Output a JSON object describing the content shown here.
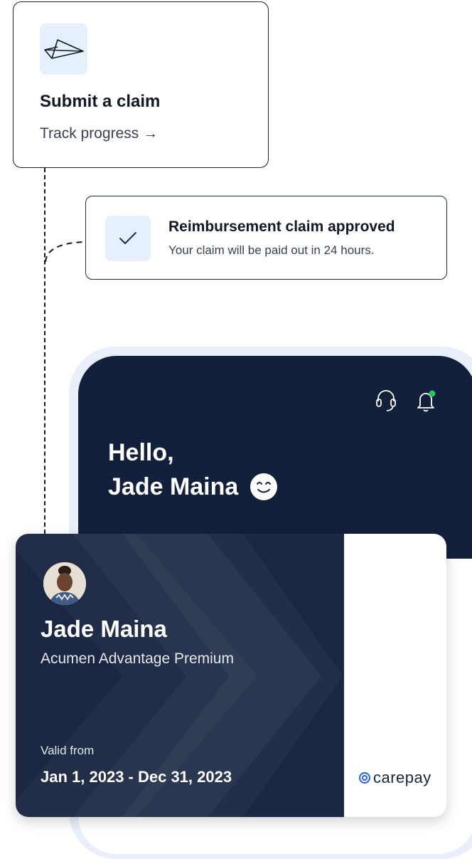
{
  "claim_card": {
    "title": "Submit a claim",
    "link": "Track progress →"
  },
  "notification": {
    "title": "Reimbursement claim approved",
    "subtitle": "Your claim will be paid out in 24 hours."
  },
  "phone": {
    "greeting_line1": "Hello,",
    "greeting_line2": "Jade Maina",
    "emoji_icon": "smiling-face-icon"
  },
  "member_card": {
    "name": "Jade Maina",
    "plan": "Acumen Advantage Premium",
    "valid_label": "Valid from",
    "valid_dates": "Jan 1, 2023 - Dec 31, 2023",
    "brand": "carepay"
  },
  "colors": {
    "navy": "#13203b",
    "card_navy": "#1b2742",
    "icon_bg": "#e6f0fd",
    "notification_dot": "#22c55e",
    "brand_accent": "#2563eb"
  }
}
